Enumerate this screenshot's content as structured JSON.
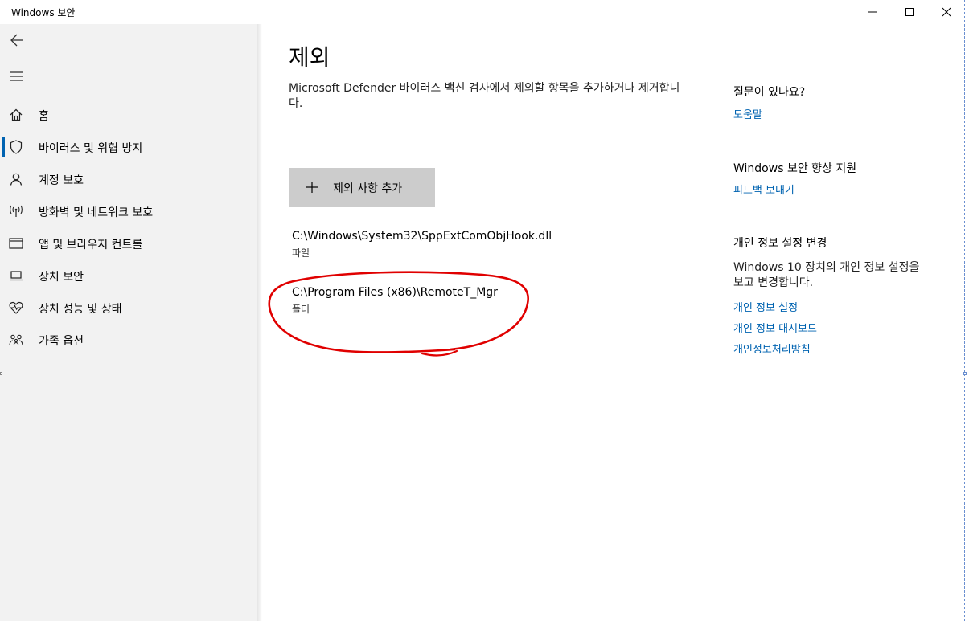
{
  "window": {
    "title": "Windows 보안",
    "controls": [
      "minimize-icon",
      "maximize-icon",
      "close-icon"
    ]
  },
  "sidebar": {
    "back_icon": "back-arrow-icon",
    "menu_icon": "hamburger-icon",
    "items": [
      {
        "label": "홈",
        "icon": "home-icon",
        "selected": false
      },
      {
        "label": "바이러스 및 위협 방지",
        "icon": "shield-icon",
        "selected": true
      },
      {
        "label": "계정 보호",
        "icon": "person-icon",
        "selected": false
      },
      {
        "label": "방화벽 및 네트워크 보호",
        "icon": "wifi-antenna-icon",
        "selected": false
      },
      {
        "label": "앱 및 브라우저 컨트롤",
        "icon": "browser-window-icon",
        "selected": false
      },
      {
        "label": "장치 보안",
        "icon": "laptop-icon",
        "selected": false
      },
      {
        "label": "장치 성능 및 상태",
        "icon": "heart-pulse-icon",
        "selected": false
      },
      {
        "label": "가족 옵션",
        "icon": "family-icon",
        "selected": false
      }
    ]
  },
  "main": {
    "title": "제외",
    "description": "Microsoft Defender 바이러스 백신 검사에서 제외할 항목을 추가하거나 제거합니다.",
    "add_button_label": "제외 사항 추가",
    "exclusions": [
      {
        "path": "C:\\Windows\\System32\\SppExtComObjHook.dll",
        "type": "파일"
      },
      {
        "path": "C:\\Program Files (x86)\\RemoteT_Mgr",
        "type": "폴더"
      }
    ]
  },
  "right_panel": {
    "help": {
      "title": "질문이 있나요?",
      "link": "도움말"
    },
    "feedback": {
      "title": "Windows 보안 향상 지원",
      "link": "피드백 보내기"
    },
    "privacy": {
      "title": "개인 정보 설정 변경",
      "text": "Windows 10 장치의 개인 정보 설정을 보고 변경합니다.",
      "links": [
        "개인 정보 설정",
        "개인 정보 대시보드",
        "개인정보처리방침"
      ]
    }
  },
  "colors": {
    "accent": "#0063b1",
    "sidebar_bg": "#f2f2f2",
    "button_bg": "#cccccc",
    "annotation": "#e00000"
  }
}
